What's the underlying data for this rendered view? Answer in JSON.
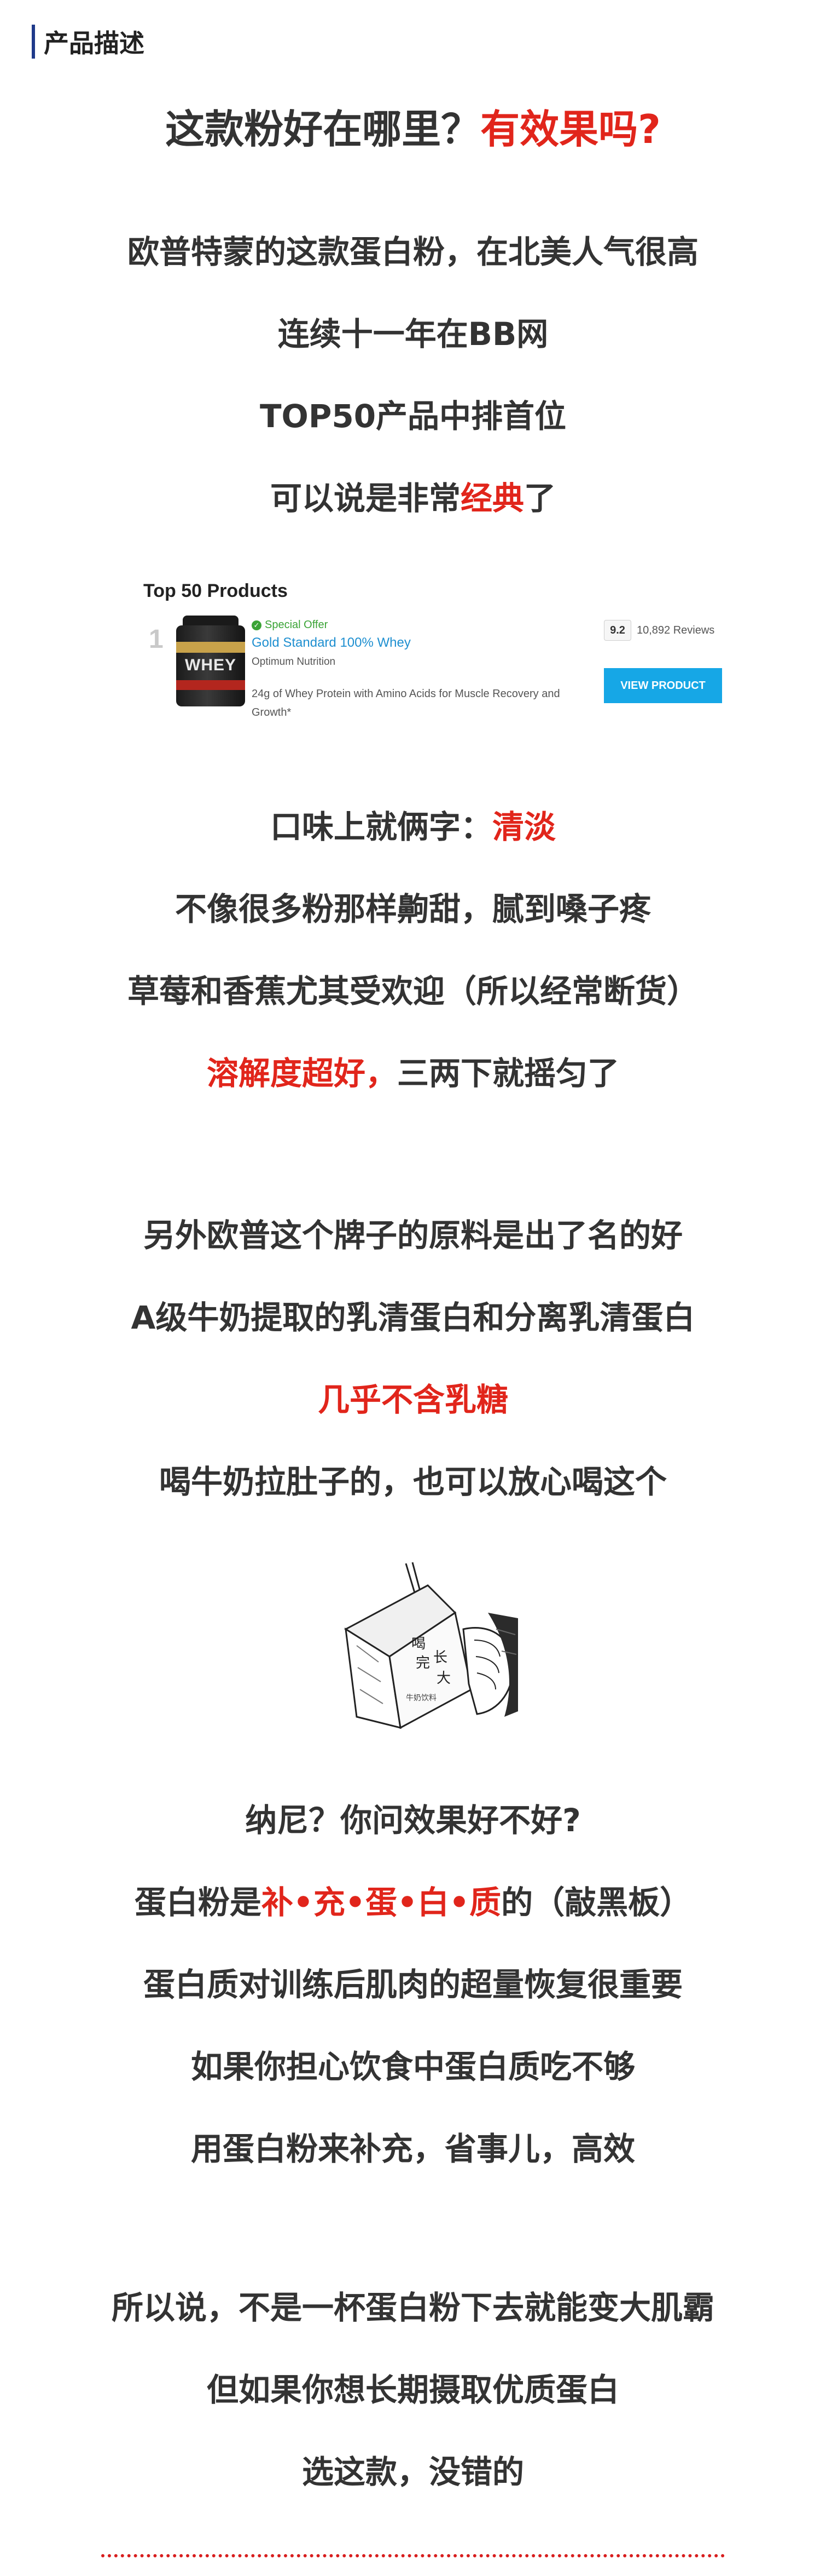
{
  "header": {
    "title": "产品描述",
    "accent": "#1f3a8a"
  },
  "headline": {
    "part1": "这款粉好在哪里？",
    "part2": "有效果吗?"
  },
  "section1": {
    "l1": "欧普特蒙的这款蛋白粉，在北美人气很高",
    "l2": "连续十一年在BB网",
    "l3": "TOP50产品中排首位",
    "l4a": "可以说是非常",
    "l4b": "经典",
    "l4c": "了"
  },
  "card": {
    "title": "Top 50 Products",
    "rank": "1",
    "tub_text": "WHEY",
    "special": "Special Offer",
    "name": "Gold Standard 100% Whey",
    "brand": "Optimum Nutrition",
    "desc": "24g of Whey Protein with Amino Acids for Muscle Recovery and Growth*",
    "rating": "9.2",
    "reviews": "10,892 Reviews",
    "button": "VIEW PRODUCT"
  },
  "section2": {
    "l1a": "口味上就俩字：",
    "l1b": "清淡",
    "l2": "不像很多粉那样齁甜，腻到嗓子疼",
    "l3": "草莓和香蕉尤其受欢迎（所以经常断货）",
    "l4a": "溶解度超好，",
    "l4b": "三两下就摇匀了"
  },
  "section3": {
    "l1": "另外欧普这个牌子的原料是出了名的好",
    "l2": "A级牛奶提取的乳清蛋白和分离乳清蛋白",
    "l3": "几乎不含乳糖",
    "l4": "喝牛奶拉肚子的，也可以放心喝这个"
  },
  "illustration": {
    "t1": "喝",
    "t2": "完",
    "t3": "长",
    "t4": "大",
    "small": "牛奶饮料"
  },
  "section4": {
    "l1": "纳尼？你问效果好不好?",
    "l2a": "蛋白粉是",
    "l2b": "补•充•蛋•白•质",
    "l2c": "的（敲黑板）",
    "l3": "蛋白质对训练后肌肉的超量恢复很重要",
    "l4": "如果你担心饮食中蛋白质吃不够",
    "l5": "用蛋白粉来补充，省事儿，高效"
  },
  "section5": {
    "l1": "所以说，不是一杯蛋白粉下去就能变大肌霸",
    "l2": "但如果你想长期摄取优质蛋白",
    "l3": "选这款，没错的"
  },
  "colors": {
    "accent_red": "#e1251b",
    "text": "#333333",
    "button_blue": "#16a7e6"
  }
}
